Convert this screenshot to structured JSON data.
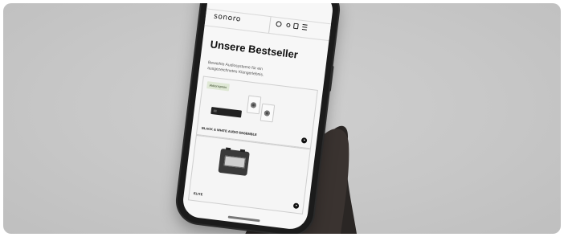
{
  "header": {
    "logo": "sonoro"
  },
  "main": {
    "title": "Unsere Bestseller",
    "subtitle": "Beweihte Audiosysteme für ein ausgezeichnetes Klangerlebnis."
  },
  "products": [
    {
      "badge": "Aktionspreis",
      "name": "BLACK & WHITE AUDIO ENSEMBLE"
    },
    {
      "badge": "",
      "name": "ELITE"
    }
  ],
  "colors": {
    "background": "#c8c8c8",
    "phone": "#1b1b1b",
    "screen": "#f7f7f7",
    "badge": "#dfe8d5"
  },
  "icons": [
    "search-icon",
    "user-icon",
    "bag-icon",
    "menu-icon",
    "arrow-right-icon"
  ]
}
